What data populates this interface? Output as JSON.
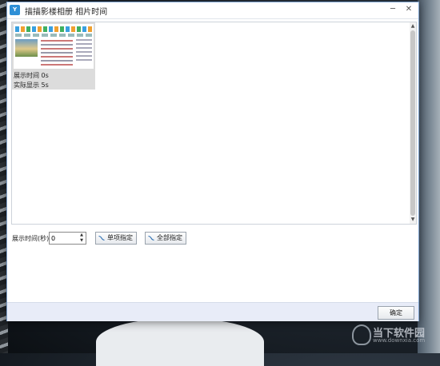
{
  "window": {
    "app_icon_text": "Y",
    "title": "描描影楼相册 相片时间",
    "minimize_glyph": "─",
    "close_glyph": "✕"
  },
  "thumbnail": {
    "display_time": "展示时间 0s",
    "actual_display": "实际显示 5s"
  },
  "scroll": {
    "up_glyph": "▲",
    "down_glyph": "▼"
  },
  "controls": {
    "display_time_label": "展示时间(秒)",
    "display_time_value": "0",
    "spin_up": "▲",
    "spin_down": "▼",
    "single_assign_label": "单项指定",
    "all_assign_label": "全部指定",
    "assign_icon": "assign-curve-icon"
  },
  "footer": {
    "ok_label": "确定"
  },
  "watermark": {
    "text": "当下软件园",
    "url": "www.downxia.com"
  },
  "colors": {
    "window_border": "#7da2ce",
    "footer_bg": "#e8ecf8",
    "thumb_bg": "#dcdcdc",
    "accent": "#2e8fd6"
  }
}
